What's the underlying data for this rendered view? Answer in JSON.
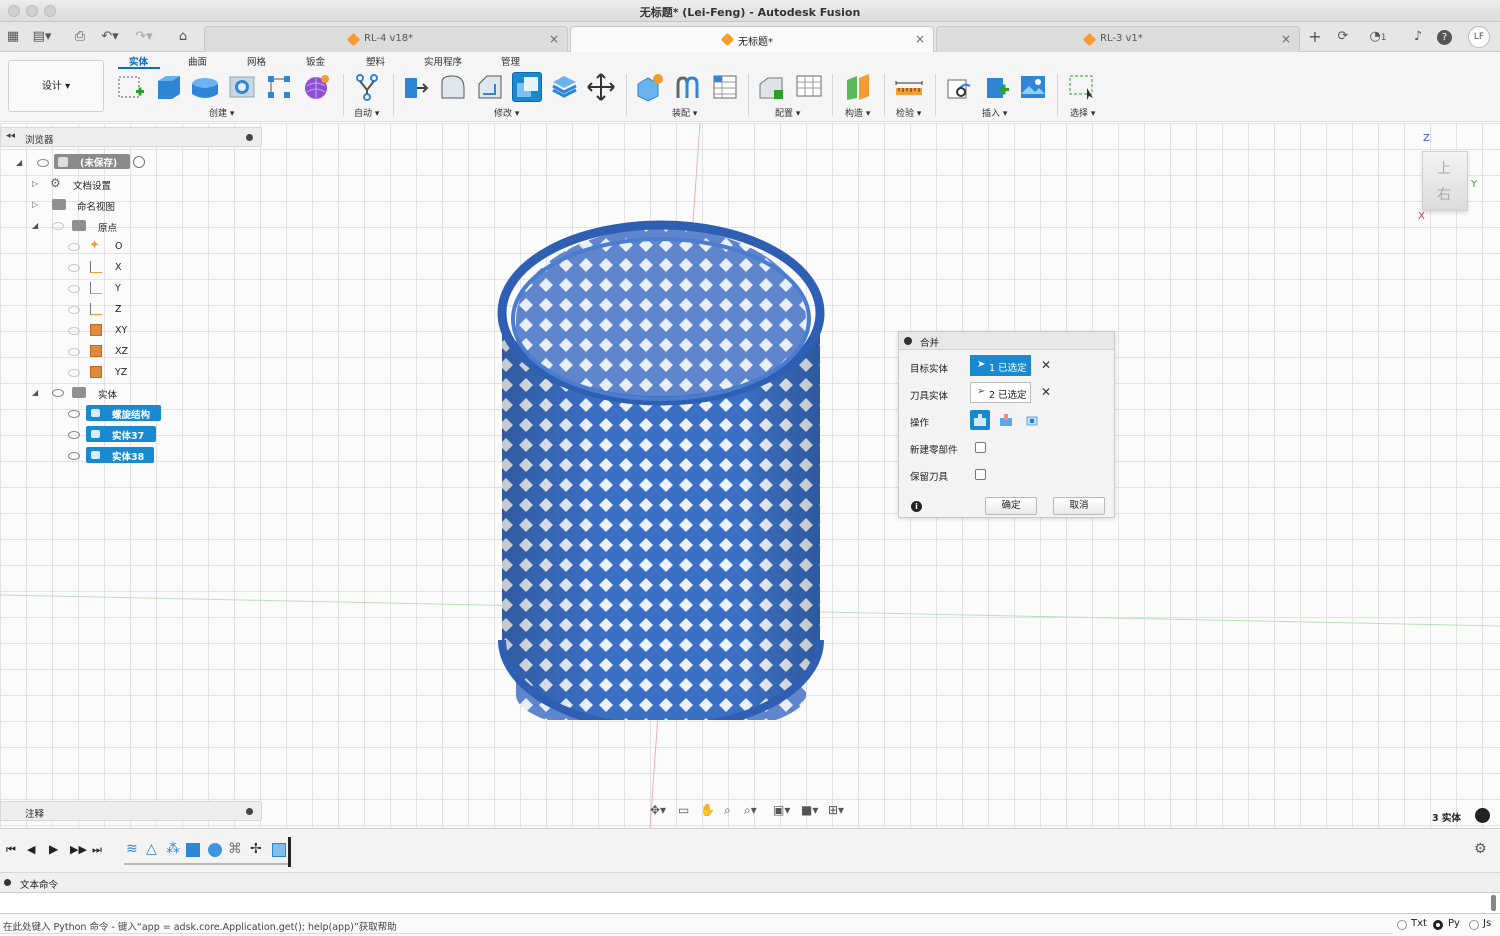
{
  "window": {
    "title": "无标题* (Lei-Feng) - Autodesk Fusion"
  },
  "tabs": [
    {
      "label": "RL-4 v18*"
    },
    {
      "label": "无标题*"
    },
    {
      "label": "RL-3 v1*"
    }
  ],
  "topright": {
    "jobs_count": "1",
    "user_initials": "LF"
  },
  "toolbar": {
    "workspace": "设计 ▾",
    "ribbon_tabs": [
      "实体",
      "曲面",
      "网格",
      "钣金",
      "塑料",
      "实用程序",
      "管理"
    ],
    "groups": {
      "create": "创建 ▾",
      "automate": "自动 ▾",
      "modify": "修改 ▾",
      "assemble": "装配 ▾",
      "configure": "配置 ▾",
      "construct": "构造 ▾",
      "inspect": "检验 ▾",
      "insert": "插入 ▾",
      "select": "选择 ▾"
    }
  },
  "browser": {
    "title": "浏览器",
    "root": "(未保存)",
    "items": {
      "doc_settings": "文档设置",
      "named_views": "命名视图",
      "origin": "原点",
      "origin_o": "O",
      "origin_x": "X",
      "origin_y": "Y",
      "origin_z": "Z",
      "origin_xy": "XY",
      "origin_xz": "XZ",
      "origin_yz": "YZ",
      "bodies": "实体",
      "body1": "螺旋结构",
      "body2": "实体37",
      "body3": "实体38"
    }
  },
  "viewcube": {
    "top": "上",
    "right": "右",
    "z": "Z",
    "y": "Y",
    "x": "X"
  },
  "dialog": {
    "title": "合并",
    "target_label": "目标实体",
    "target_value": "1 已选定",
    "tool_label": "刀具实体",
    "tool_value": "2 已选定",
    "operation_label": "操作",
    "new_component_label": "新建零部件",
    "keep_tools_label": "保留刀具",
    "ok": "确定",
    "cancel": "取消"
  },
  "notes": {
    "title": "注释"
  },
  "status": {
    "bodies_count": "3 实体"
  },
  "text_commands": {
    "title": "文本命令"
  },
  "prompt": {
    "text": "在此处键入 Python 命令 - 键入“app = adsk.core.Application.get(); help(app)”获取帮助",
    "modes": [
      "Txt",
      "Py",
      "Js"
    ],
    "selected_mode": "Py"
  },
  "colors": {
    "accent": "#1a8ad0",
    "model": "#3b6fc4",
    "tab_orange": "#f39c33"
  }
}
